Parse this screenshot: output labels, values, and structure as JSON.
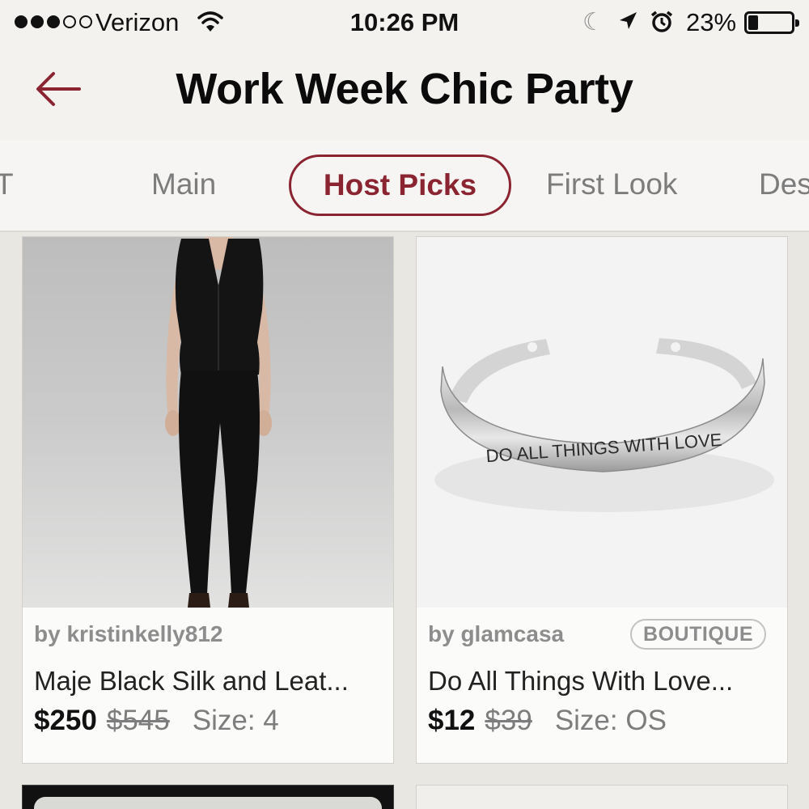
{
  "status_bar": {
    "carrier": "Verizon",
    "time": "10:26 PM",
    "battery": "23%",
    "battery_level": 0.23,
    "signal_bars": 3,
    "signal_max": 5,
    "icons": [
      "wifi-icon",
      "moon-icon",
      "location-arrow-icon",
      "alarm-clock-icon",
      "battery-icon"
    ]
  },
  "header": {
    "title": "Work Week Chic Party",
    "back_icon": "arrow-left-icon"
  },
  "tabs": [
    {
      "label": "T",
      "active": false
    },
    {
      "label": "Main",
      "active": false
    },
    {
      "label": "Host Picks",
      "active": true
    },
    {
      "label": "First Look",
      "active": false
    },
    {
      "label": "Des",
      "active": false
    }
  ],
  "colors": {
    "accent": "#8b2431",
    "background": "#e9e7e2",
    "header_bg": "#f4f2ef"
  },
  "listings": [
    {
      "seller": "by kristinkelly812",
      "badge": "",
      "title": "Maje Black Silk and Leat...",
      "price": "$250",
      "original_price": "$545",
      "size": "Size: 4",
      "image": "black-jumpsuit-photo"
    },
    {
      "seller": "by glamcasa",
      "badge": "BOUTIQUE",
      "title": "Do All Things With Love...",
      "price": "$12",
      "original_price": "$39",
      "size": "Size: OS",
      "image": "silver-cuff-bracelet-photo",
      "image_text": "DO ALL THINGS WITH LOVE"
    }
  ]
}
